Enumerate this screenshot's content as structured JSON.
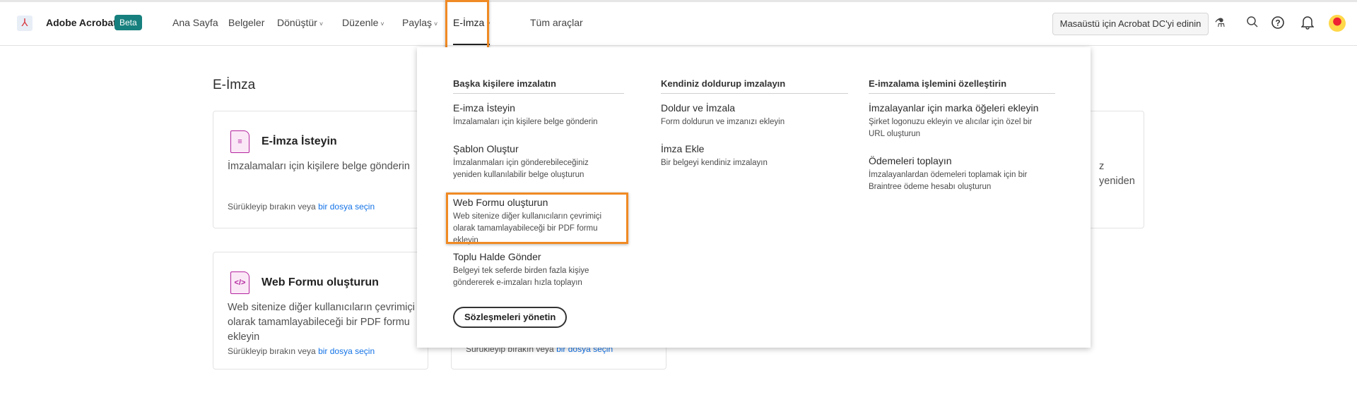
{
  "header": {
    "app_name": "Adobe Acrobat",
    "badge": "Beta",
    "nav": [
      {
        "label": "Ana Sayfa"
      },
      {
        "label": "Belgeler"
      },
      {
        "label": "Dönüştür",
        "chevron": "˅"
      },
      {
        "label": "Düzenle",
        "chevron": "˅"
      },
      {
        "label": "Paylaş",
        "chevron": "˅"
      },
      {
        "label": "E-İmza",
        "chevron": "˅"
      },
      {
        "label": "Tüm araçlar"
      }
    ],
    "desktop_button": "Masaüstü için Acrobat DC'yi edinin",
    "icons": [
      "flask-icon",
      "search-icon",
      "help-icon",
      "bell-icon",
      "avatar"
    ]
  },
  "page": {
    "title": "E-İmza",
    "cards": [
      {
        "title": "E-İmza İsteyin",
        "desc": "İmzalamaları için kişilere belge gönderin",
        "foot": "Sürükleyip bırakın veya",
        "link": "bir dosya seçin",
        "icon": "sign-document-icon"
      },
      {
        "title": "Web Formu oluşturun",
        "desc": "Web sitenize diğer kullanıcıların çevrimiçi olarak tamamlayabileceği bir PDF formu ekleyin",
        "foot": "Sürükleyip bırakın veya",
        "link": "bir dosya seçin",
        "icon": "code-document-icon"
      }
    ],
    "partial_right_text": "z yeniden",
    "partial_middle_foot": "Sürükleyip bırakın veya",
    "partial_middle_link": "bir dosya seçin"
  },
  "dropdown": {
    "columns": [
      {
        "heading": "Başka kişilere imzalatın",
        "items": [
          {
            "title": "E-imza İsteyin",
            "desc": "İmzalamaları için kişilere belge gönderin"
          },
          {
            "title": "Şablon Oluştur",
            "desc": "İmzalanmaları için gönderebileceğiniz yeniden kullanılabilir belge oluşturun"
          },
          {
            "title": "Web Formu oluşturun",
            "desc": "Web sitenize diğer kullanıcıların çevrimiçi olarak tamamlayabileceği bir PDF formu ekleyin"
          },
          {
            "title": "Toplu Halde Gönder",
            "desc": "Belgeyi tek seferde birden fazla kişiye göndererek e-imzaları hızla toplayın"
          }
        ]
      },
      {
        "heading": "Kendiniz doldurup imzalayın",
        "items": [
          {
            "title": "Doldur ve İmzala",
            "desc": "Form doldurun ve imzanızı ekleyin"
          },
          {
            "title": "İmza Ekle",
            "desc": "Bir belgeyi kendiniz imzalayın"
          }
        ]
      },
      {
        "heading": "E-imzalama işlemini özelleştirin",
        "items": [
          {
            "title": "İmzalayanlar için marka öğeleri ekleyin",
            "desc": "Şirket logonuzu ekleyin ve alıcılar için özel bir URL oluşturun"
          },
          {
            "title": "Ödemeleri toplayın",
            "desc": "İmzalayanlardan ödemeleri toplamak için bir Braintree ödeme hesabı oluşturun"
          }
        ]
      }
    ],
    "manage_button": "Sözleşmeleri yönetin"
  },
  "colors": {
    "accent": "#1473e6",
    "badge": "#17807e",
    "highlight": "#f08a24",
    "icon": "#b3249e"
  }
}
